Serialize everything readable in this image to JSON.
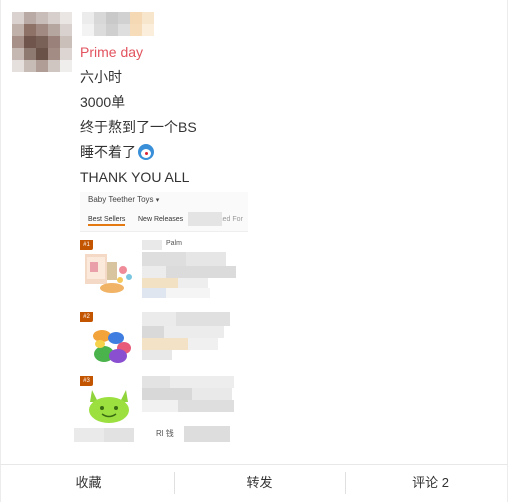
{
  "post": {
    "tag": "Prime day",
    "lines": [
      "六小时",
      "3000单",
      "终于熬到了一个BS",
      "睡不着了",
      "THANK YOU ALL"
    ],
    "emoji": "doraemon-emoji"
  },
  "screenshot": {
    "title": "Baby Teether Toys",
    "chevron": "▾",
    "tabs": [
      "Best Sellers",
      "New Releases",
      "Most Wished For"
    ],
    "rows": [
      {
        "rank": "#1",
        "name_fragment": "Palm"
      },
      {
        "rank": "#2",
        "name_fragment": ""
      },
      {
        "rank": "#3",
        "name_fragment": ""
      }
    ],
    "bottom_fragment": "Rl 钱"
  },
  "actions": {
    "favorite": "收藏",
    "repost": "转发",
    "comment": "评论 2"
  },
  "colors": {
    "tag": "#e2535e",
    "amazon_orange": "#e47911",
    "rank_badge": "#c45500"
  }
}
